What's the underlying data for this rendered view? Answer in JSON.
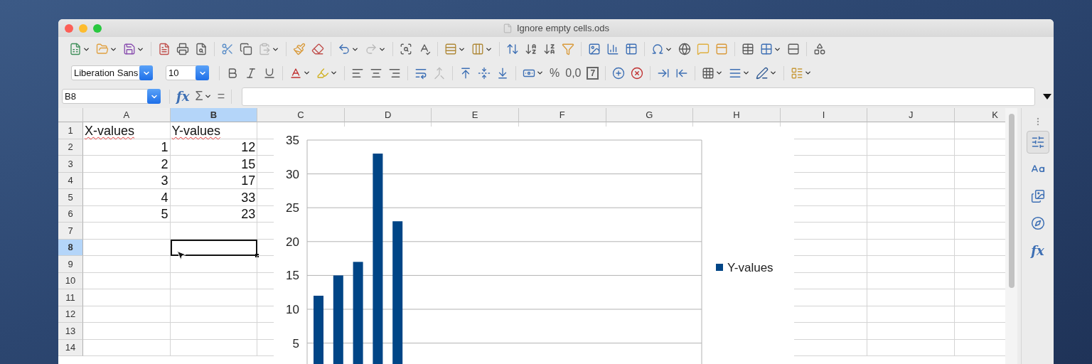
{
  "window": {
    "title": "Ignore empty cells.ods"
  },
  "toolbar_standard": [
    {
      "buttons": [
        {
          "kind": "split",
          "disabled": false
        },
        {
          "kind": "split",
          "disabled": false
        },
        {
          "kind": "split",
          "disabled": false
        }
      ]
    },
    {
      "buttons": [
        {
          "kind": "button",
          "disabled": false
        },
        {
          "kind": "button",
          "disabled": false
        },
        {
          "kind": "button",
          "disabled": false
        }
      ]
    },
    {
      "buttons": [
        {
          "kind": "button",
          "disabled": false
        },
        {
          "kind": "button",
          "disabled": false
        },
        {
          "kind": "split",
          "disabled": true
        }
      ]
    },
    {
      "buttons": [
        {
          "kind": "button",
          "disabled": false
        },
        {
          "kind": "button",
          "disabled": false
        }
      ]
    },
    {
      "buttons": [
        {
          "kind": "split",
          "disabled": false
        },
        {
          "kind": "split",
          "disabled": true
        }
      ]
    },
    {
      "buttons": [
        {
          "kind": "button",
          "disabled": false
        },
        {
          "kind": "button",
          "disabled": false
        }
      ]
    },
    {
      "buttons": [
        {
          "kind": "split",
          "disabled": false
        },
        {
          "kind": "split",
          "disabled": false
        }
      ]
    },
    {
      "buttons": [
        {
          "kind": "button",
          "disabled": false
        },
        {
          "kind": "button",
          "disabled": false
        },
        {
          "kind": "button",
          "disabled": false
        },
        {
          "kind": "button",
          "disabled": false
        }
      ]
    },
    {
      "buttons": [
        {
          "kind": "button",
          "disabled": false
        },
        {
          "kind": "button",
          "disabled": false
        },
        {
          "kind": "button",
          "disabled": false
        }
      ]
    },
    {
      "buttons": [
        {
          "kind": "split",
          "disabled": false
        },
        {
          "kind": "button",
          "disabled": false
        },
        {
          "kind": "button",
          "disabled": false
        },
        {
          "kind": "button",
          "disabled": false
        }
      ]
    },
    {
      "buttons": [
        {
          "kind": "button",
          "disabled": false
        },
        {
          "kind": "split",
          "disabled": false
        },
        {
          "kind": "button",
          "disabled": false
        }
      ]
    },
    {
      "buttons": [
        {
          "kind": "button",
          "disabled": false
        }
      ]
    }
  ],
  "font_name": "Liberation Sans",
  "font_size": "10",
  "toolbar_formatting": [
    {
      "buttons": [
        {
          "kind": "button",
          "disabled": false
        },
        {
          "kind": "button",
          "disabled": false
        },
        {
          "kind": "button",
          "disabled": false
        }
      ]
    },
    {
      "buttons": [
        {
          "kind": "split",
          "disabled": false
        },
        {
          "kind": "split",
          "disabled": false
        }
      ]
    },
    {
      "buttons": [
        {
          "kind": "button",
          "disabled": false
        },
        {
          "kind": "button",
          "disabled": false
        },
        {
          "kind": "button",
          "disabled": false
        }
      ]
    },
    {
      "buttons": [
        {
          "kind": "button",
          "disabled": false
        },
        {
          "kind": "button",
          "disabled": true
        }
      ]
    },
    {
      "buttons": [
        {
          "kind": "button",
          "disabled": false
        },
        {
          "kind": "button",
          "disabled": false
        },
        {
          "kind": "button",
          "disabled": false
        }
      ]
    },
    {
      "buttons": [
        {
          "kind": "split",
          "disabled": false
        },
        {
          "kind": "label",
          "label": "%",
          "disabled": false
        },
        {
          "kind": "label",
          "label": "0,0",
          "disabled": false
        },
        {
          "kind": "boxed",
          "label": "7",
          "disabled": false
        }
      ]
    },
    {
      "buttons": [
        {
          "kind": "button",
          "disabled": false
        },
        {
          "kind": "button",
          "disabled": false
        }
      ]
    },
    {
      "buttons": [
        {
          "kind": "button",
          "disabled": false
        },
        {
          "kind": "button",
          "disabled": false
        }
      ]
    },
    {
      "buttons": [
        {
          "kind": "split",
          "disabled": false
        },
        {
          "kind": "split",
          "disabled": false
        },
        {
          "kind": "split",
          "disabled": false
        }
      ]
    },
    {
      "buttons": [
        {
          "kind": "split",
          "disabled": false
        }
      ]
    }
  ],
  "formula_bar": {
    "name_box": "B8",
    "function_wizard": "fx",
    "sum": "Σ",
    "equals": "="
  },
  "columns": [
    {
      "label": "A",
      "selected": false
    },
    {
      "label": "B",
      "selected": true
    },
    {
      "label": "C",
      "selected": false
    },
    {
      "label": "D",
      "selected": false
    },
    {
      "label": "E",
      "selected": false
    },
    {
      "label": "F",
      "selected": false
    },
    {
      "label": "G",
      "selected": false
    },
    {
      "label": "H",
      "selected": false
    },
    {
      "label": "I",
      "selected": false
    },
    {
      "label": "J",
      "selected": false
    },
    {
      "label": "K",
      "selected": false
    }
  ],
  "rows": [
    {
      "header": "1",
      "selected": false,
      "cells": [
        {
          "text": "X-values",
          "kind": "text",
          "spell_error": true
        },
        {
          "text": "Y-values",
          "kind": "text",
          "spell_error": true
        }
      ]
    },
    {
      "header": "2",
      "selected": false,
      "cells": [
        {
          "text": "1",
          "kind": "number",
          "spell_error": false
        },
        {
          "text": "12",
          "kind": "number",
          "spell_error": false
        }
      ]
    },
    {
      "header": "3",
      "selected": false,
      "cells": [
        {
          "text": "2",
          "kind": "number",
          "spell_error": false
        },
        {
          "text": "15",
          "kind": "number",
          "spell_error": false
        }
      ]
    },
    {
      "header": "4",
      "selected": false,
      "cells": [
        {
          "text": "3",
          "kind": "number",
          "spell_error": false
        },
        {
          "text": "17",
          "kind": "number",
          "spell_error": false
        }
      ]
    },
    {
      "header": "5",
      "selected": false,
      "cells": [
        {
          "text": "4",
          "kind": "number",
          "spell_error": false
        },
        {
          "text": "33",
          "kind": "number",
          "spell_error": false
        }
      ]
    },
    {
      "header": "6",
      "selected": false,
      "cells": [
        {
          "text": "5",
          "kind": "number",
          "spell_error": false
        },
        {
          "text": "23",
          "kind": "number",
          "spell_error": false
        }
      ]
    },
    {
      "header": "7",
      "selected": false
    },
    {
      "header": "8",
      "selected": true
    },
    {
      "header": "9",
      "selected": false
    },
    {
      "header": "10",
      "selected": false
    },
    {
      "header": "11",
      "selected": false
    },
    {
      "header": "12",
      "selected": false
    },
    {
      "header": "13",
      "selected": false
    },
    {
      "header": "14",
      "selected": false
    }
  ],
  "chart": {
    "chart_data": {
      "type": "bar",
      "series": [
        {
          "name": "Y-values",
          "color": "#004586",
          "values": [
            12,
            15,
            17,
            33,
            23
          ]
        }
      ],
      "ylim": [
        0,
        35
      ],
      "grid": true,
      "yticks": [
        5,
        10,
        15,
        20,
        25,
        30,
        35
      ]
    }
  },
  "sidebar": [
    {
      "selected": true
    },
    {
      "selected": false
    },
    {
      "selected": false
    },
    {
      "selected": false
    },
    {
      "selected": false,
      "label": "fx"
    }
  ]
}
